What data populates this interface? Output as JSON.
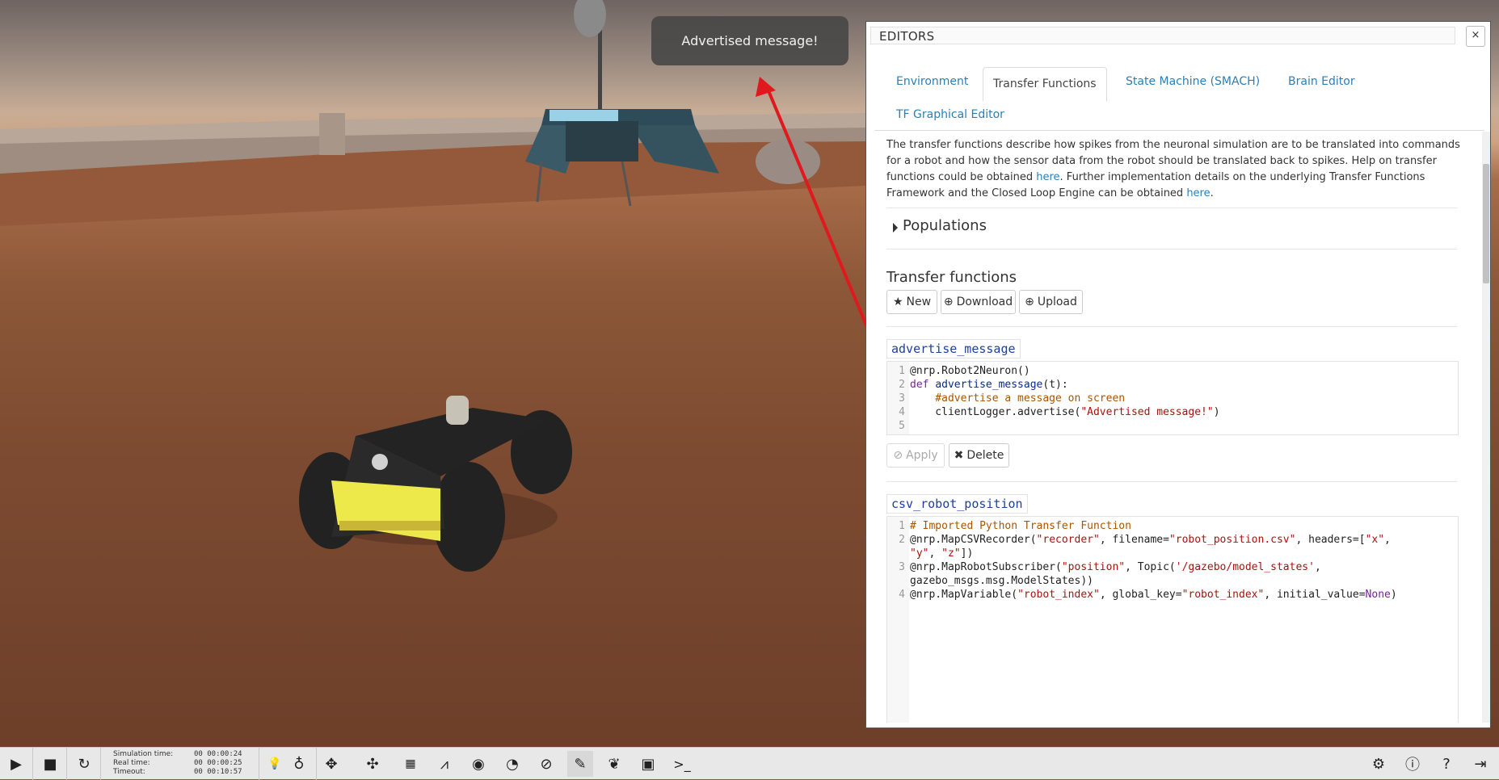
{
  "toast": {
    "message": "Advertised message!"
  },
  "editors": {
    "title": "EDITORS",
    "close_label": "×",
    "tabs": [
      {
        "label": "Environment",
        "active": false
      },
      {
        "label": "Transfer Functions",
        "active": true
      },
      {
        "label": "State Machine (SMACH)",
        "active": false
      },
      {
        "label": "Brain Editor",
        "active": false
      },
      {
        "label": "TF Graphical Editor",
        "active": false
      }
    ],
    "description": {
      "part1": "The transfer functions describe how spikes from the neuronal simulation are to be translated into commands for a robot and how the sensor data from the robot should be translated back to spikes. Help on transfer functions could be obtained ",
      "link1": "here",
      "part2": ". Further implementation details on the underlying Transfer Functions Framework and the Closed Loop Engine can be obtained ",
      "link2": "here",
      "part3": "."
    },
    "populations_label": "Populations",
    "tf_heading": "Transfer functions",
    "buttons": {
      "new": "New",
      "download": "Download",
      "upload": "Upload",
      "apply": "Apply",
      "delete": "Delete"
    },
    "transfer_functions": [
      {
        "name": "advertise_message",
        "line_numbers": [
          "1",
          "2",
          "3",
          "4",
          "5"
        ],
        "code": {
          "l1": "@nrp.Robot2Neuron()",
          "l2_kw": "def ",
          "l2_fn": "advertise_message",
          "l2_rest": "(t):",
          "l3": "    #advertise a message on screen",
          "l4_a": "    clientLogger.advertise(",
          "l4_str": "\"Advertised message!\"",
          "l4_b": ")",
          "l5": ""
        }
      },
      {
        "name": "csv_robot_position",
        "line_numbers": [
          "1",
          "2",
          "3",
          "4"
        ],
        "code": {
          "l1": "# Imported Python Transfer Function",
          "l2a_a": "@nrp.MapCSVRecorder(",
          "l2a_s1": "\"recorder\"",
          "l2a_b": ", filename=",
          "l2a_s2": "\"robot_position.csv\"",
          "l2a_c": ", headers=[",
          "l2a_s3": "\"x\"",
          "l2a_d": ",",
          "l2b_s1": "\"y\"",
          "l2b_a": ", ",
          "l2b_s2": "\"z\"",
          "l2b_b": "])",
          "l3a_a": "@nrp.MapRobotSubscriber(",
          "l3a_s1": "\"position\"",
          "l3a_b": ", Topic(",
          "l3a_s2": "'/gazebo/model_states'",
          "l3a_c": ",",
          "l3b": "gazebo_msgs.msg.ModelStates))",
          "l4_a": "@nrp.MapVariable(",
          "l4_s1": "\"robot_index\"",
          "l4_b": ", global_key=",
          "l4_s2": "\"robot_index\"",
          "l4_c": ", initial_value=",
          "l4_kw": "None",
          "l4_d": ")"
        }
      }
    ]
  },
  "toolbar": {
    "sim_time_label": "Simulation time:",
    "sim_time_value": "00 00:00:24",
    "real_time_label": "Real time:",
    "real_time_value": "00 00:00:25",
    "timeout_label": "Timeout:",
    "timeout_value": "00 00:10:57",
    "icons": [
      "play-icon",
      "stop-icon",
      "reset-icon",
      "light-icon",
      "bulb-icon",
      "move-icon",
      "rotate-icon",
      "grid-icon",
      "plot-icon",
      "eye-icon",
      "spike-icon",
      "compass-icon",
      "edit-icon",
      "brain-icon",
      "video-icon",
      "terminal-icon",
      "settings-icon",
      "info-icon",
      "help-icon",
      "exit-icon"
    ]
  }
}
